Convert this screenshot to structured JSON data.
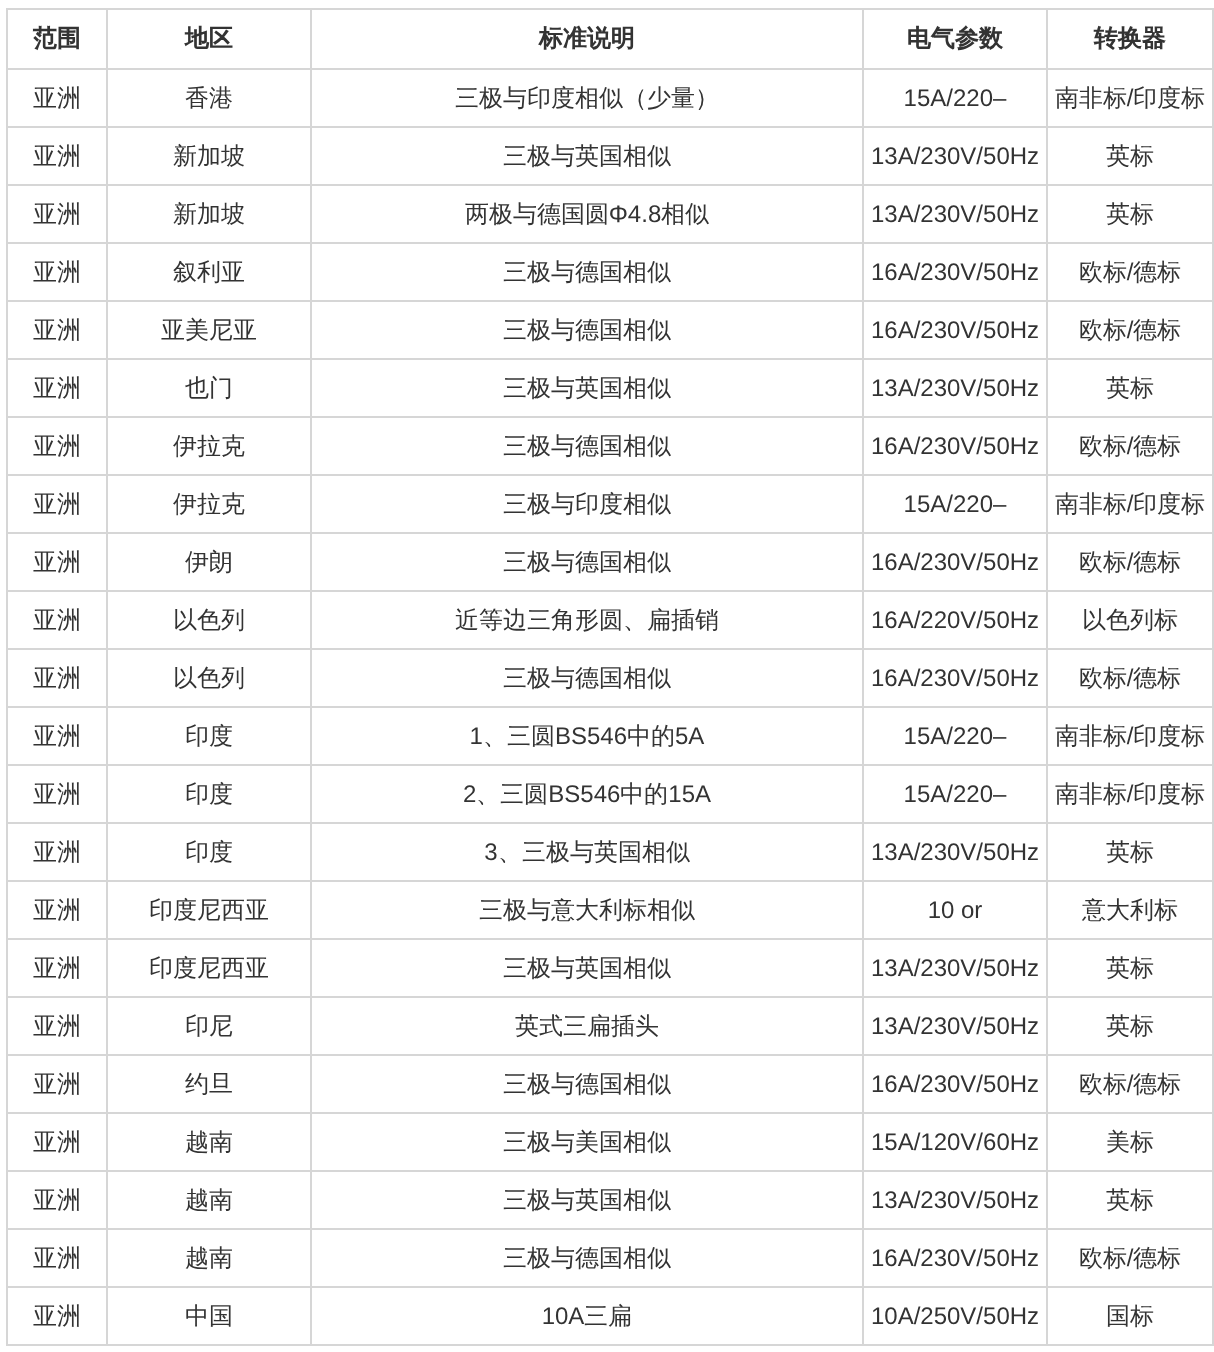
{
  "table": {
    "columns": [
      "范围",
      "地区",
      "标准说明",
      "电气参数",
      "转换器"
    ],
    "rows": [
      [
        "亚洲",
        "香港",
        "三极与印度相似（少量）",
        "15A/220–",
        "南非标/印度标"
      ],
      [
        "亚洲",
        "新加坡",
        "三极与英国相似",
        "13A/230V/50Hz",
        "英标"
      ],
      [
        "亚洲",
        "新加坡",
        "两极与德国圆Φ4.8相似",
        "13A/230V/50Hz",
        "英标"
      ],
      [
        "亚洲",
        "叙利亚",
        "三极与德国相似",
        "16A/230V/50Hz",
        "欧标/德标"
      ],
      [
        "亚洲",
        "亚美尼亚",
        "三极与德国相似",
        "16A/230V/50Hz",
        "欧标/德标"
      ],
      [
        "亚洲",
        "也门",
        "三极与英国相似",
        "13A/230V/50Hz",
        "英标"
      ],
      [
        "亚洲",
        "伊拉克",
        "三极与德国相似",
        "16A/230V/50Hz",
        "欧标/德标"
      ],
      [
        "亚洲",
        "伊拉克",
        "三极与印度相似",
        "15A/220–",
        "南非标/印度标"
      ],
      [
        "亚洲",
        "伊朗",
        "三极与德国相似",
        "16A/230V/50Hz",
        "欧标/德标"
      ],
      [
        "亚洲",
        "以色列",
        "近等边三角形圆、扁插销",
        "16A/220V/50Hz",
        "以色列标"
      ],
      [
        "亚洲",
        "以色列",
        "三极与德国相似",
        "16A/230V/50Hz",
        "欧标/德标"
      ],
      [
        "亚洲",
        "印度",
        "1、三圆BS546中的5A",
        "15A/220–",
        "南非标/印度标"
      ],
      [
        "亚洲",
        "印度",
        "2、三圆BS546中的15A",
        "15A/220–",
        "南非标/印度标"
      ],
      [
        "亚洲",
        "印度",
        "3、三极与英国相似",
        "13A/230V/50Hz",
        "英标"
      ],
      [
        "亚洲",
        "印度尼西亚",
        "三极与意大利标相似",
        "10 or",
        "意大利标"
      ],
      [
        "亚洲",
        "印度尼西亚",
        "三极与英国相似",
        "13A/230V/50Hz",
        "英标"
      ],
      [
        "亚洲",
        "印尼",
        "英式三扁插头",
        "13A/230V/50Hz",
        "英标"
      ],
      [
        "亚洲",
        "约旦",
        "三极与德国相似",
        "16A/230V/50Hz",
        "欧标/德标"
      ],
      [
        "亚洲",
        "越南",
        "三极与美国相似",
        "15A/120V/60Hz",
        "美标"
      ],
      [
        "亚洲",
        "越南",
        "三极与英国相似",
        "13A/230V/50Hz",
        "英标"
      ],
      [
        "亚洲",
        "越南",
        "三极与德国相似",
        "16A/230V/50Hz",
        "欧标/德标"
      ],
      [
        "亚洲",
        "中国",
        "10A三扁",
        "10A/250V/50Hz",
        "国标"
      ]
    ]
  }
}
